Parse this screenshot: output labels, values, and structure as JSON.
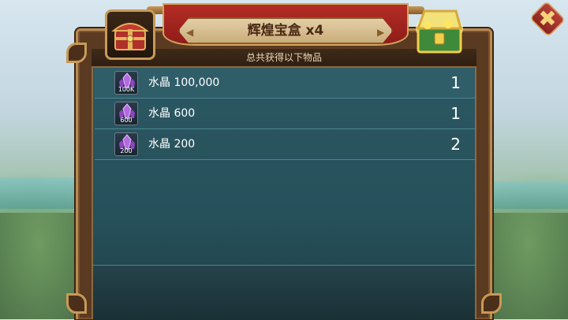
{
  "title": "辉煌宝盒 x4",
  "subtitle": "总共获得以下物品",
  "close_label": "✖",
  "icons": {
    "box": "red-gift-box-icon",
    "chest": "gold-treasure-chest-icon",
    "item": "purple-crystal-icon"
  },
  "colors": {
    "title_banner": "#b42d25",
    "panel": "#2c5863",
    "frame_gold": "#c79a58",
    "crystal": "#b56ae0"
  },
  "items": [
    {
      "name": "水晶 100,000",
      "badge": "100K",
      "qty": "1"
    },
    {
      "name": "水晶 600",
      "badge": "600",
      "qty": "1"
    },
    {
      "name": "水晶 200",
      "badge": "200",
      "qty": "2"
    }
  ]
}
